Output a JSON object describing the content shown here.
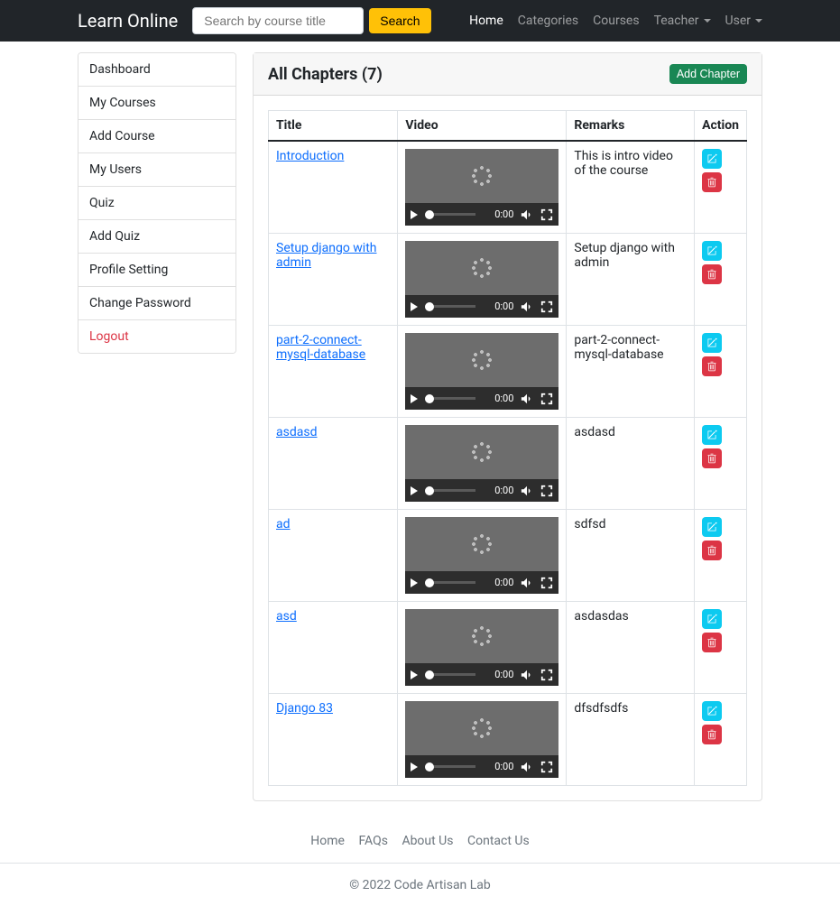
{
  "navbar": {
    "brand": "Learn Online",
    "search_placeholder": "Search by course title",
    "search_button": "Search",
    "links": {
      "home": "Home",
      "categories": "Categories",
      "courses": "Courses",
      "teacher": "Teacher",
      "user": "User"
    }
  },
  "sidebar": {
    "items": [
      "Dashboard",
      "My Courses",
      "Add Course",
      "My Users",
      "Quiz",
      "Add Quiz",
      "Profile Setting",
      "Change Password",
      "Logout"
    ]
  },
  "page": {
    "title": "All Chapters (7)",
    "add_button": "Add Chapter",
    "columns": {
      "title": "Title",
      "video": "Video",
      "remarks": "Remarks",
      "action": "Action"
    },
    "video_time": "0:00",
    "chapters": [
      {
        "title": "Introduction",
        "remarks": "This is intro video of the course"
      },
      {
        "title": "Setup django with admin",
        "remarks": "Setup django with admin"
      },
      {
        "title": "part-2-connect-mysql-database",
        "remarks": "part-2-connect-mysql-database"
      },
      {
        "title": "asdasd",
        "remarks": "asdasd"
      },
      {
        "title": "ad",
        "remarks": "sdfsd"
      },
      {
        "title": "asd",
        "remarks": "asdasdas"
      },
      {
        "title": "Django 83",
        "remarks": "dfsdfsdfs"
      }
    ]
  },
  "footer": {
    "links": {
      "home": "Home",
      "faqs": "FAQs",
      "about": "About Us",
      "contact": "Contact Us"
    },
    "copyright": "© 2022 Code Artisan Lab"
  }
}
